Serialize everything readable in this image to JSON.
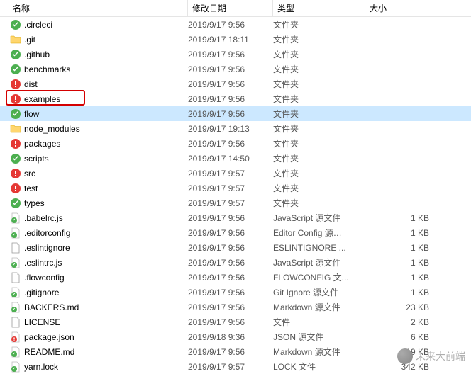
{
  "columns": {
    "name": "名称",
    "date": "修改日期",
    "type": "类型",
    "size": "大小"
  },
  "icon_types": {
    "folder": "folder",
    "green": "green-folder",
    "red": "red-folder",
    "greenfile": "green-file",
    "redfile": "red-file",
    "file": "file"
  },
  "files": [
    {
      "name": ".circleci",
      "date": "2019/9/17 9:56",
      "type": "文件夹",
      "size": "",
      "icon": "green",
      "highlighted": false
    },
    {
      "name": ".git",
      "date": "2019/9/17 18:11",
      "type": "文件夹",
      "size": "",
      "icon": "folder",
      "highlighted": false
    },
    {
      "name": ".github",
      "date": "2019/9/17 9:56",
      "type": "文件夹",
      "size": "",
      "icon": "green",
      "highlighted": false
    },
    {
      "name": "benchmarks",
      "date": "2019/9/17 9:56",
      "type": "文件夹",
      "size": "",
      "icon": "green",
      "highlighted": false
    },
    {
      "name": "dist",
      "date": "2019/9/17 9:56",
      "type": "文件夹",
      "size": "",
      "icon": "red",
      "highlighted": false
    },
    {
      "name": "examples",
      "date": "2019/9/17 9:56",
      "type": "文件夹",
      "size": "",
      "icon": "red",
      "highlighted": true
    },
    {
      "name": "flow",
      "date": "2019/9/17 9:56",
      "type": "文件夹",
      "size": "",
      "icon": "green",
      "highlighted": false,
      "selected": true
    },
    {
      "name": "node_modules",
      "date": "2019/9/17 19:13",
      "type": "文件夹",
      "size": "",
      "icon": "folder",
      "highlighted": false
    },
    {
      "name": "packages",
      "date": "2019/9/17 9:56",
      "type": "文件夹",
      "size": "",
      "icon": "red",
      "highlighted": false
    },
    {
      "name": "scripts",
      "date": "2019/9/17 14:50",
      "type": "文件夹",
      "size": "",
      "icon": "green",
      "highlighted": false
    },
    {
      "name": "src",
      "date": "2019/9/17 9:57",
      "type": "文件夹",
      "size": "",
      "icon": "red",
      "highlighted": false
    },
    {
      "name": "test",
      "date": "2019/9/17 9:57",
      "type": "文件夹",
      "size": "",
      "icon": "red",
      "highlighted": false
    },
    {
      "name": "types",
      "date": "2019/9/17 9:57",
      "type": "文件夹",
      "size": "",
      "icon": "green",
      "highlighted": false
    },
    {
      "name": ".babelrc.js",
      "date": "2019/9/17 9:56",
      "type": "JavaScript 源文件",
      "size": "1 KB",
      "icon": "greenfile",
      "highlighted": false
    },
    {
      "name": ".editorconfig",
      "date": "2019/9/17 9:56",
      "type": "Editor Config 源…",
      "size": "1 KB",
      "icon": "greenfile",
      "highlighted": false
    },
    {
      "name": ".eslintignore",
      "date": "2019/9/17 9:56",
      "type": "ESLINTIGNORE ...",
      "size": "1 KB",
      "icon": "file",
      "highlighted": false
    },
    {
      "name": ".eslintrc.js",
      "date": "2019/9/17 9:56",
      "type": "JavaScript 源文件",
      "size": "1 KB",
      "icon": "greenfile",
      "highlighted": false
    },
    {
      "name": ".flowconfig",
      "date": "2019/9/17 9:56",
      "type": "FLOWCONFIG 文...",
      "size": "1 KB",
      "icon": "file",
      "highlighted": false
    },
    {
      "name": ".gitignore",
      "date": "2019/9/17 9:56",
      "type": "Git Ignore 源文件",
      "size": "1 KB",
      "icon": "greenfile",
      "highlighted": false
    },
    {
      "name": "BACKERS.md",
      "date": "2019/9/17 9:56",
      "type": "Markdown 源文件",
      "size": "23 KB",
      "icon": "greenfile",
      "highlighted": false
    },
    {
      "name": "LICENSE",
      "date": "2019/9/17 9:56",
      "type": "文件",
      "size": "2 KB",
      "icon": "file",
      "highlighted": false
    },
    {
      "name": "package.json",
      "date": "2019/9/18 9:36",
      "type": "JSON 源文件",
      "size": "6 KB",
      "icon": "redfile",
      "highlighted": false
    },
    {
      "name": "README.md",
      "date": "2019/9/17 9:56",
      "type": "Markdown 源文件",
      "size": "19 KB",
      "icon": "greenfile",
      "highlighted": false
    },
    {
      "name": "yarn.lock",
      "date": "2019/9/17 9:57",
      "type": "LOCK 文件",
      "size": "342 KB",
      "icon": "greenfile",
      "highlighted": false
    }
  ],
  "watermark": "未来大前端"
}
